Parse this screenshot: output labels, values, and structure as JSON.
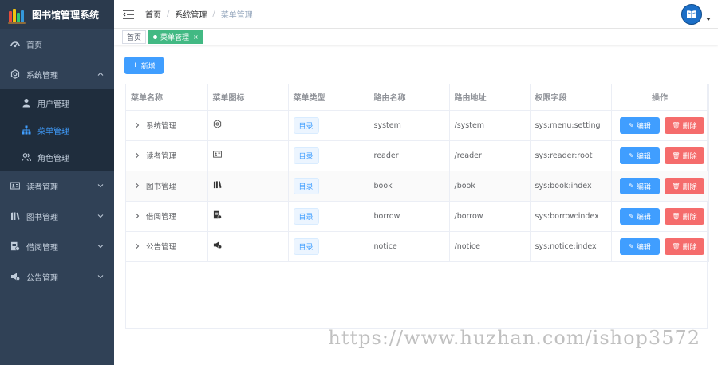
{
  "app": {
    "title": "图书馆管理系统"
  },
  "sidebar": {
    "items": [
      {
        "label": "首页",
        "icon": "dashboard-icon"
      },
      {
        "label": "系统管理",
        "icon": "settings-icon",
        "expanded": true,
        "children": [
          {
            "label": "用户管理",
            "icon": "user-icon"
          },
          {
            "label": "菜单管理",
            "icon": "tree-icon",
            "active": true
          },
          {
            "label": "角色管理",
            "icon": "peoples-icon"
          }
        ]
      },
      {
        "label": "读者管理",
        "icon": "reader-card-icon"
      },
      {
        "label": "图书管理",
        "icon": "books-icon"
      },
      {
        "label": "借阅管理",
        "icon": "borrow-icon"
      },
      {
        "label": "公告管理",
        "icon": "notice-icon"
      }
    ]
  },
  "header": {
    "breadcrumb": [
      "首页",
      "系统管理",
      "菜单管理"
    ]
  },
  "tags": [
    {
      "label": "首页",
      "active": false,
      "close": ""
    },
    {
      "label": "菜单管理",
      "active": true,
      "close": "×"
    }
  ],
  "toolbar": {
    "add_label": "新增",
    "add_icon": "+"
  },
  "table": {
    "columns": [
      "菜单名称",
      "菜单图标",
      "菜单类型",
      "路由名称",
      "路由地址",
      "权限字段",
      "操作"
    ],
    "edit_label": "编辑",
    "delete_label": "删除",
    "rows": [
      {
        "name": "系统管理",
        "icon": "settings-icon",
        "type": "目录",
        "route_name": "system",
        "route_path": "/system",
        "perms": "sys:menu:setting"
      },
      {
        "name": "读者管理",
        "icon": "reader-card-icon",
        "type": "目录",
        "route_name": "reader",
        "route_path": "/reader",
        "perms": "sys:reader:root"
      },
      {
        "name": "图书管理",
        "icon": "books-icon",
        "type": "目录",
        "route_name": "book",
        "route_path": "/book",
        "perms": "sys:book:index"
      },
      {
        "name": "借阅管理",
        "icon": "borrow-icon",
        "type": "目录",
        "route_name": "borrow",
        "route_path": "/borrow",
        "perms": "sys:borrow:index"
      },
      {
        "name": "公告管理",
        "icon": "notice-icon",
        "type": "目录",
        "route_name": "notice",
        "route_path": "/notice",
        "perms": "sys:notice:index"
      }
    ]
  },
  "watermark": "https://www.huzhan.com/ishop3572",
  "colors": {
    "sidebar": "#304156",
    "accent": "#409eff",
    "danger": "#f56c6c",
    "tag_active": "#42b983"
  }
}
